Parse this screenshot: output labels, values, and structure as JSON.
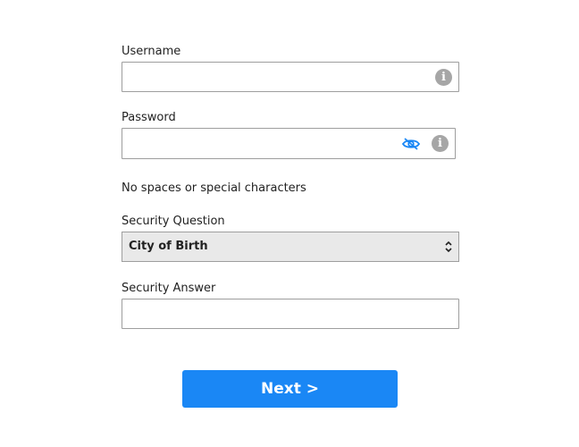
{
  "form": {
    "username": {
      "label": "Username",
      "value": "",
      "info_icon": "info-icon"
    },
    "password": {
      "label": "Password",
      "value": "",
      "visibility_icon": "eye-slash-icon",
      "info_icon": "info-icon"
    },
    "password_hint": "No spaces or special characters",
    "security_question": {
      "label": "Security Question",
      "selected": "City of Birth",
      "arrows_icon": "chevron-up-down-icon"
    },
    "security_answer": {
      "label": "Security Answer",
      "value": ""
    },
    "next_button": {
      "label": "Next >"
    }
  },
  "colors": {
    "accent": "#1a87f5",
    "icon_gray": "#a6a6a6",
    "border": "#9e9e9e",
    "select_bg": "#e9e9e9"
  }
}
